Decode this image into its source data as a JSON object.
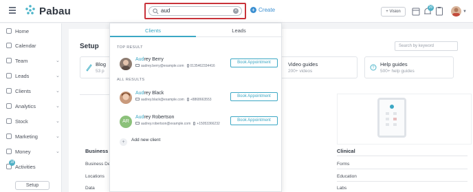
{
  "app": {
    "name": "Pabau"
  },
  "header": {
    "search_value": "aud",
    "create_label": "Create",
    "vision_label": "+ Vision",
    "notif_count": "20"
  },
  "sidebar": {
    "items": [
      {
        "label": "Home",
        "chevron": false
      },
      {
        "label": "Calendar",
        "chevron": false
      },
      {
        "label": "Team",
        "chevron": true
      },
      {
        "label": "Leads",
        "chevron": true
      },
      {
        "label": "Clients",
        "chevron": true
      },
      {
        "label": "Analytics",
        "chevron": true
      },
      {
        "label": "Stock",
        "chevron": true
      },
      {
        "label": "Marketing",
        "chevron": true
      },
      {
        "label": "Money",
        "chevron": true
      },
      {
        "label": "Activities",
        "chevron": false
      }
    ],
    "activities_badge": "18",
    "setup_label": "Setup"
  },
  "main": {
    "title": "Setup",
    "keyword_placeholder": "Search by keyword",
    "cards": [
      {
        "title": "Blog",
        "sub": "53 p"
      },
      {
        "title": "Video guides",
        "sub": "200+ videos"
      },
      {
        "title": "Help guides",
        "sub": "500+ help guides"
      }
    ],
    "business": {
      "title": "Business",
      "items": [
        "Business De",
        "Locations",
        "Data"
      ]
    },
    "clinical": {
      "title": "Clinical",
      "items": [
        "Forms",
        "Education",
        "Labs"
      ]
    }
  },
  "dropdown": {
    "tabs": [
      "Clients",
      "Leads"
    ],
    "top_result_label": "TOP RESULT",
    "all_results_label": "ALL RESULTS",
    "top_result": {
      "name_hl": "Aud",
      "name_rest": "rey Berry",
      "email": "audrey.berry@example.com",
      "phone": "0135462334416"
    },
    "all_results": [
      {
        "name_hl": "Aud",
        "name_rest": "rey Black",
        "email": "audrey.black@example.com",
        "phone": "+8868663553"
      },
      {
        "name_hl": "Aud",
        "name_rest": "rey Robertson",
        "email": "audrey.robertson@example.com",
        "phone": "+15053366232",
        "initials": "AR"
      }
    ],
    "book_label": "Book Appointment",
    "add_client_label": "Add new client"
  },
  "colors": {
    "accent": "#3ba7c4",
    "highlight_border": "#c8323a",
    "initials_bg": "#8bc17a"
  }
}
